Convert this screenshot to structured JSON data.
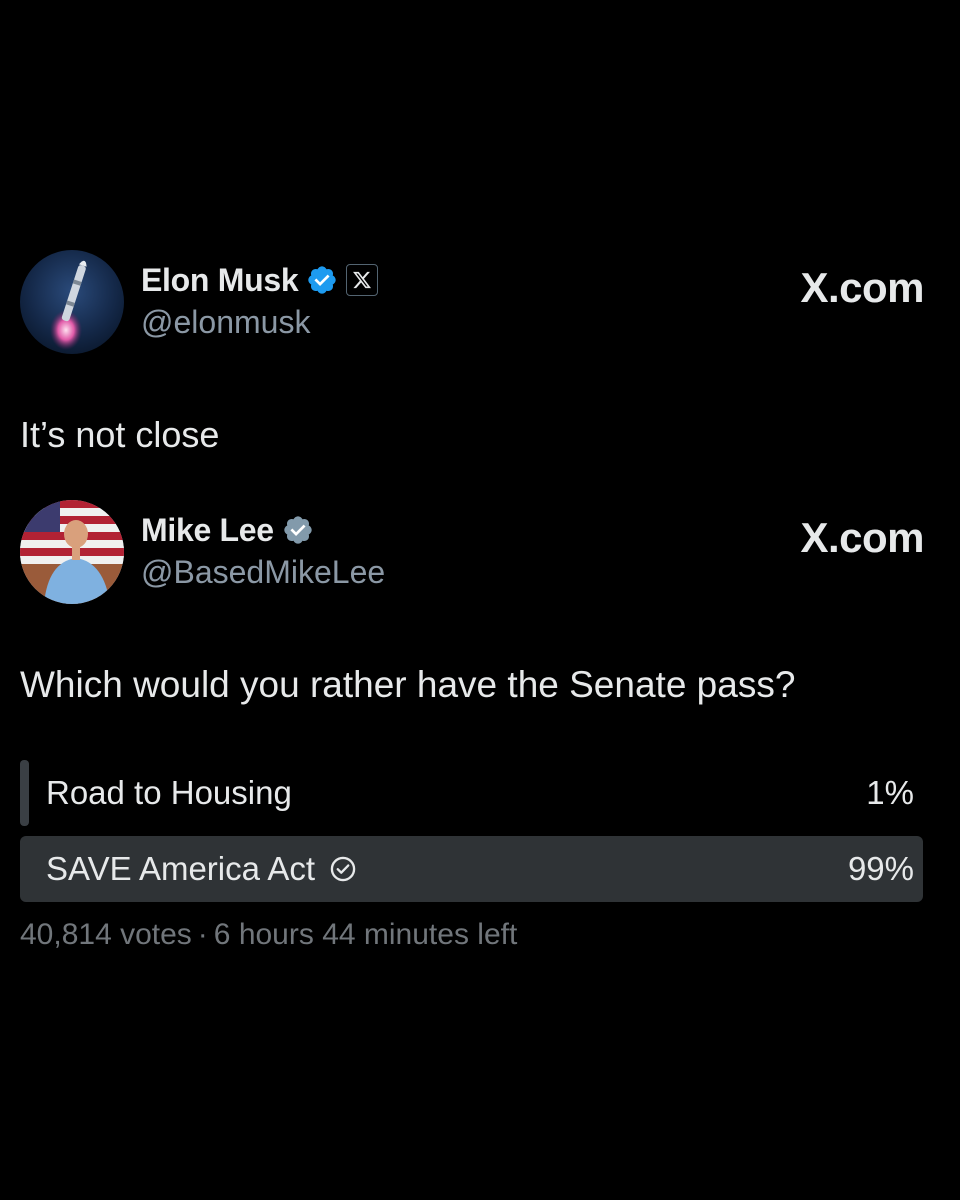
{
  "main_post": {
    "author": {
      "display_name": "Elon Musk",
      "handle": "@elonmusk",
      "verified": true,
      "verified_color": "#1d9bf0",
      "affiliate_badge": "x-logo-icon"
    },
    "brand": "X.com",
    "text": "It’s not close"
  },
  "quoted_post": {
    "author": {
      "display_name": "Mike Lee",
      "handle": "@BasedMikeLee",
      "verified": true,
      "verified_color": "#829aab"
    },
    "brand": "X.com",
    "text": "Which would you rather have the Senate pass?",
    "poll": {
      "options": [
        {
          "label": "Road to Housing",
          "percent_label": "1%",
          "percent": 1,
          "winner": false
        },
        {
          "label": "SAVE America Act",
          "percent_label": "99%",
          "percent": 99,
          "winner": true
        }
      ],
      "votes": "40,814 votes",
      "separator": "·",
      "time_left": "6 hours 44 minutes left"
    }
  }
}
